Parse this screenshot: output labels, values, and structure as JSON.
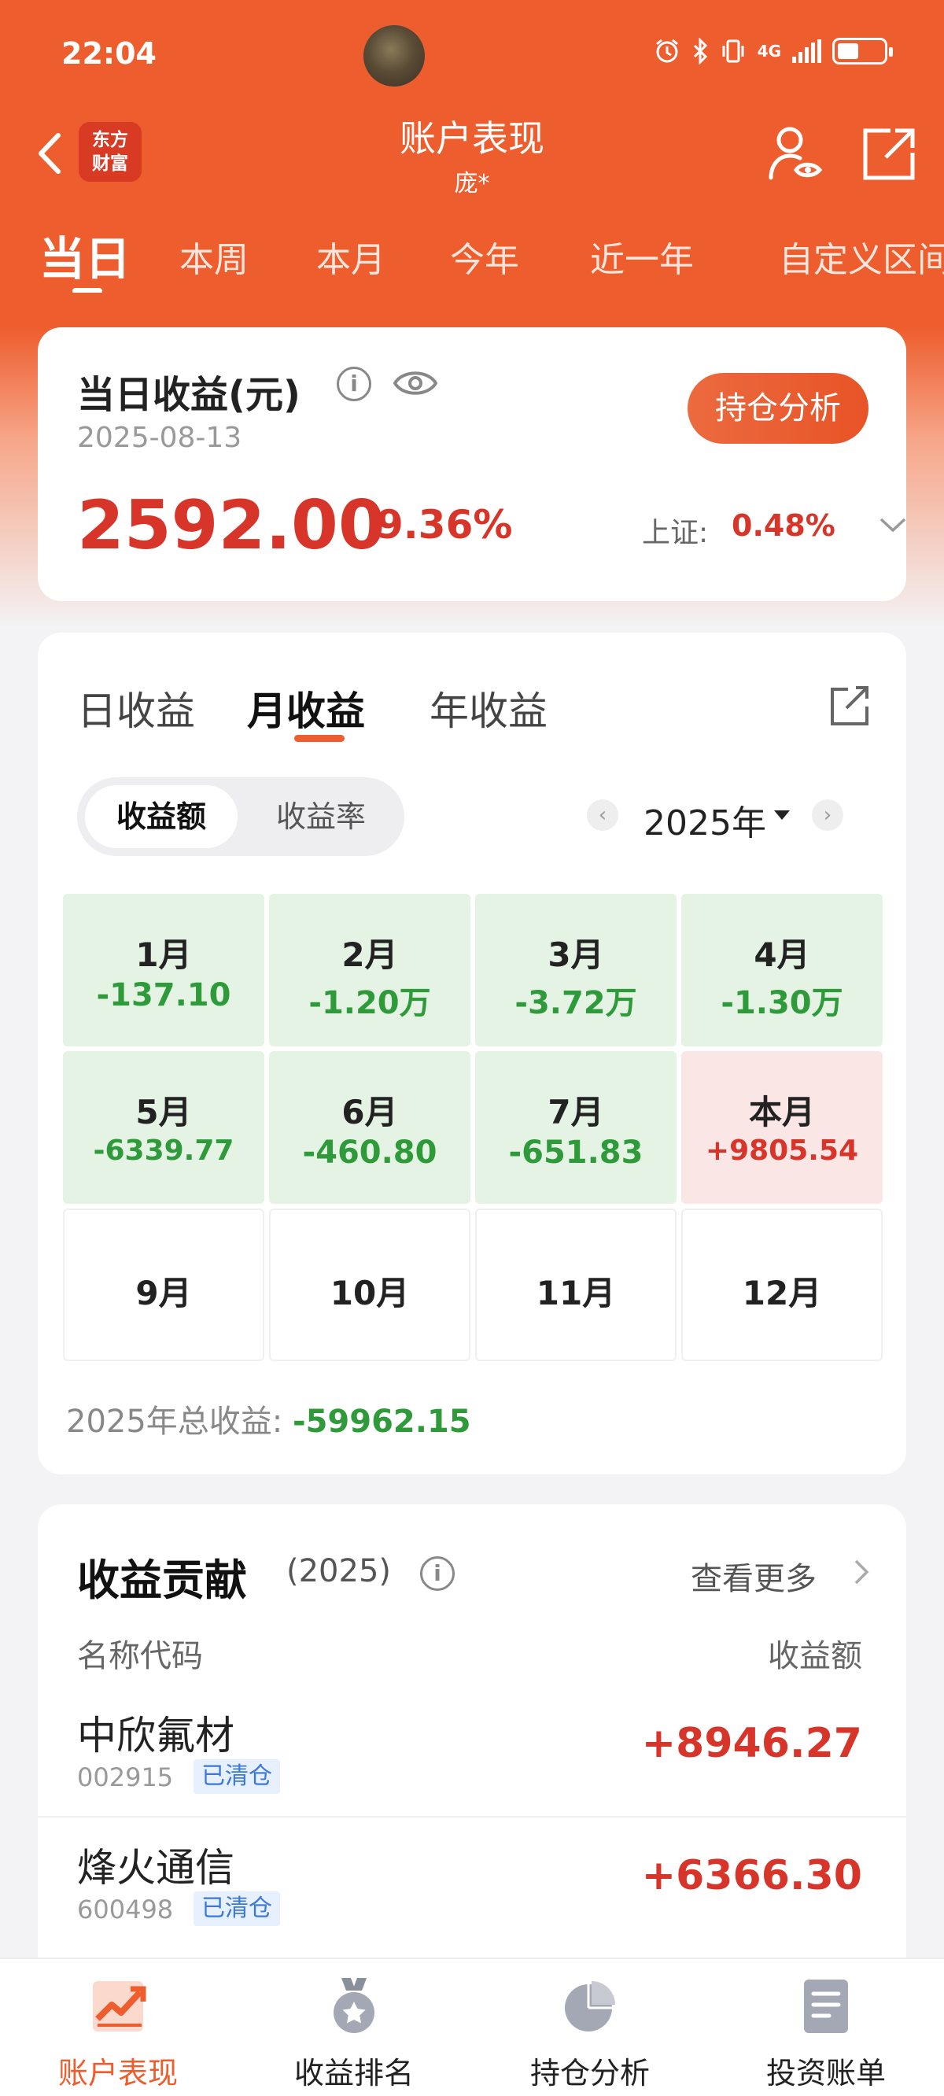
{
  "status_bar": {
    "time": "22:04",
    "network": "4G"
  },
  "header": {
    "logo_line1": "东方",
    "logo_line2": "财富",
    "title": "账户表现",
    "subtitle": "庞*"
  },
  "period_tabs": [
    {
      "label": "当日",
      "active": true
    },
    {
      "label": "本周"
    },
    {
      "label": "本月"
    },
    {
      "label": "今年"
    },
    {
      "label": "近一年"
    },
    {
      "label": "自定义区间"
    }
  ],
  "today": {
    "title": "当日收益(元)",
    "info_glyph": "i",
    "date": "2025-08-13",
    "holdings_button": "持仓分析",
    "amount": "2592.00",
    "percent": "9.36%",
    "index_label": "上证:",
    "index_value": "0.48%"
  },
  "monthly": {
    "tabs": [
      {
        "label": "日收益"
      },
      {
        "label": "月收益",
        "active": true
      },
      {
        "label": "年收益"
      }
    ],
    "segment": {
      "amount": "收益额",
      "rate": "收益率"
    },
    "year_label": "2025年",
    "prev_glyph": "‹",
    "next_glyph": "›",
    "months": [
      {
        "label": "1月",
        "value": "-137.10",
        "type": "loss"
      },
      {
        "label": "2月",
        "value": "-1.20万",
        "type": "loss"
      },
      {
        "label": "3月",
        "value": "-3.72万",
        "type": "loss"
      },
      {
        "label": "4月",
        "value": "-1.30万",
        "type": "loss"
      },
      {
        "label": "5月",
        "value": "-6339.77",
        "type": "loss"
      },
      {
        "label": "6月",
        "value": "-460.80",
        "type": "loss"
      },
      {
        "label": "7月",
        "value": "-651.83",
        "type": "loss"
      },
      {
        "label": "本月",
        "value": "+9805.54",
        "type": "gain"
      },
      {
        "label": "9月",
        "value": "",
        "type": "empty"
      },
      {
        "label": "10月",
        "value": "",
        "type": "empty"
      },
      {
        "label": "11月",
        "value": "",
        "type": "empty"
      },
      {
        "label": "12月",
        "value": "",
        "type": "empty"
      }
    ],
    "total_label": "2025年总收益:",
    "total_value": "-59962.15"
  },
  "contribution": {
    "title": "收益贡献",
    "year": "(2025)",
    "more": "查看更多",
    "col_name": "名称代码",
    "col_value": "收益额",
    "rows": [
      {
        "name": "中欣氟材",
        "code": "002915",
        "tag": "已清仓",
        "value": "+8946.27"
      },
      {
        "name": "烽火通信",
        "code": "600498",
        "tag": "已清仓",
        "value": "+6366.30"
      }
    ]
  },
  "bottom_nav": [
    {
      "label": "账户表现",
      "icon": "chart-trend-icon",
      "active": true
    },
    {
      "label": "收益排名",
      "icon": "medal-icon"
    },
    {
      "label": "持仓分析",
      "icon": "pie-chart-icon"
    },
    {
      "label": "投资账单",
      "icon": "bill-icon"
    }
  ],
  "colors": {
    "brand": "#ee5d2e",
    "gain": "#d8352a",
    "loss": "#2e9a3a"
  }
}
